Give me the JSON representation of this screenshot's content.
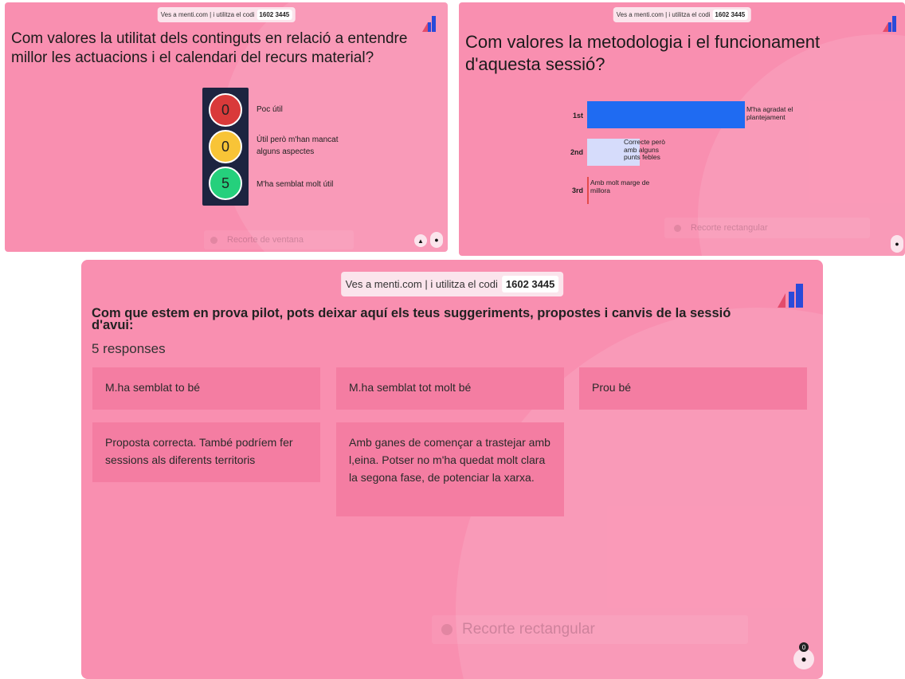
{
  "join": {
    "prefix": "Ves a menti.com | i utilitza el codi",
    "code": "1602 3445"
  },
  "slide1": {
    "title": "Com valores la utilitat dels continguts en relació a entendre millor les actuacions i el calendari del recurs material?",
    "options": [
      {
        "count": "0",
        "label": "Poc útil",
        "color": "#d93a3a"
      },
      {
        "count": "0",
        "label": "Útil però m'han mancat alguns aspectes",
        "color": "#f8c437"
      },
      {
        "count": "5",
        "label": "M'ha semblat molt útil",
        "color": "#25d07c"
      }
    ],
    "ghost": "Recorte de ventana"
  },
  "slide2": {
    "title": "Com valores la metodologia i el funcionament d'aquesta sessió?",
    "chart_data": {
      "type": "bar",
      "orientation": "horizontal",
      "categories": [
        "M'ha agradat el plantejament",
        "Correcte però amb alguns punts febles",
        "Amb molt marge de millora"
      ],
      "ranks": [
        "1st",
        "2nd",
        "3rd"
      ],
      "values": [
        3,
        1,
        0
      ],
      "colors": [
        "#1f6bf2",
        "#d6dcfb",
        "#e34b4b"
      ]
    },
    "ghost": "Recorte rectangular"
  },
  "slide3": {
    "title": "Com que estem en prova pilot, pots deixar aquí els teus suggeriments, propostes i canvis de la sessió d'avui:",
    "count_label": "5 responses",
    "responses": [
      "M.ha semblat to bé",
      "M.ha semblat tot molt bé",
      "Prou bé",
      "Proposta correcta. També podríem fer sessions als diferents territoris",
      "Amb ganes de començar a trastejar amb l,eina. Potser no m'ha quedat molt clara la segona fase, de potenciar la xarxa."
    ],
    "ghost": "Recorte rectangular",
    "participants": "0"
  },
  "colors": {
    "slide_bg": "#f98fb0",
    "card_bg": "#f47da2",
    "logo_blue": "#2a4ad9",
    "logo_red": "#e34b6b"
  }
}
